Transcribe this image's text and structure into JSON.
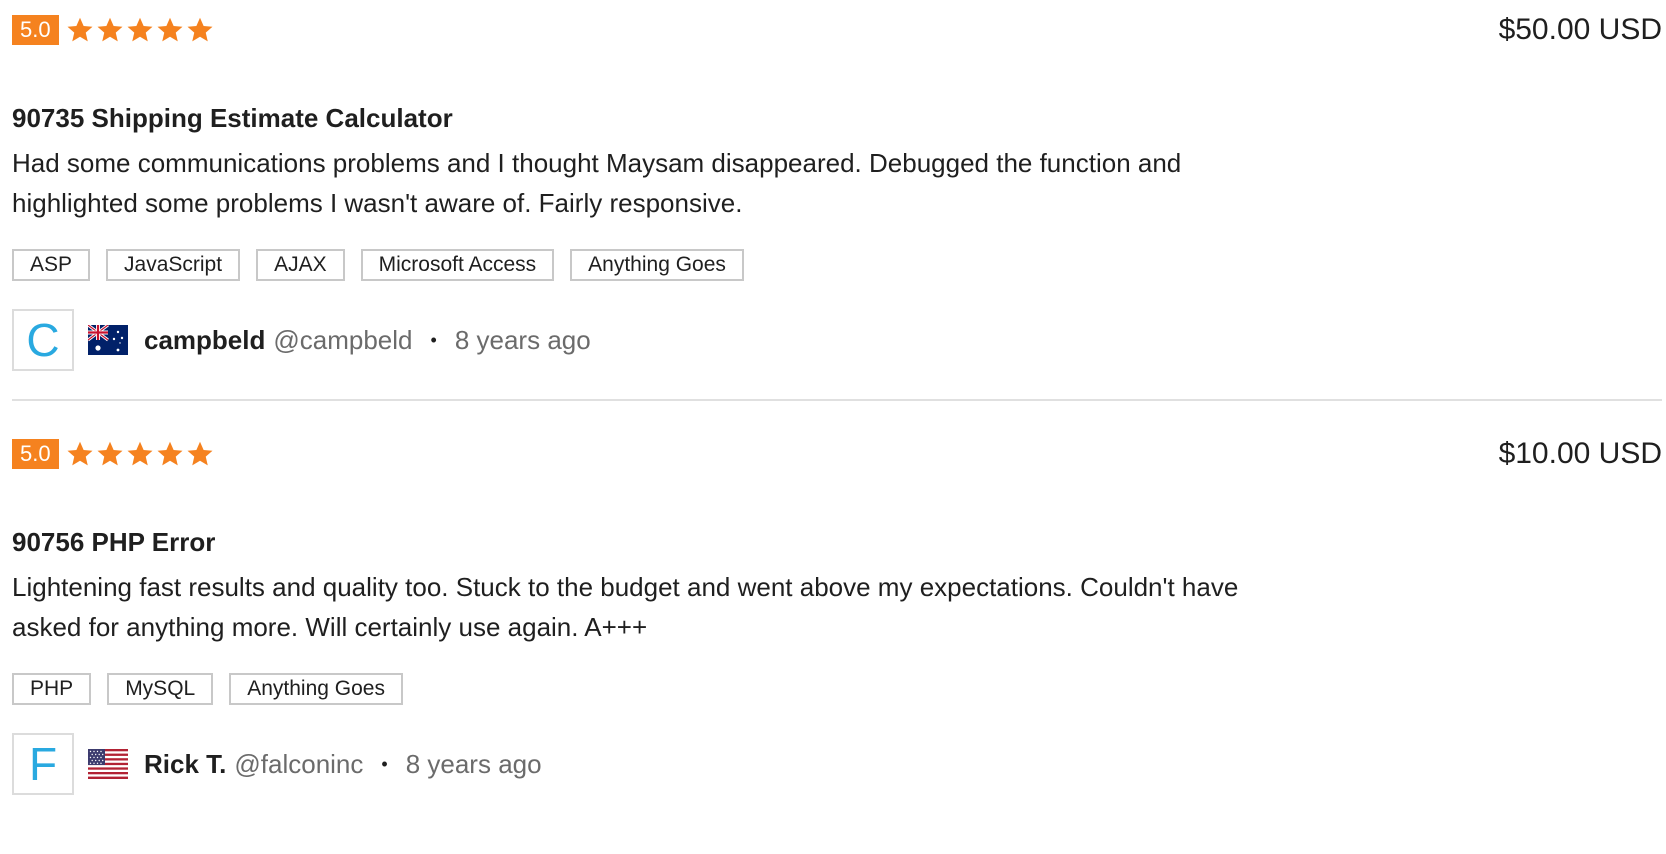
{
  "colors": {
    "accent": "#f5821f",
    "avatar_letter": "#29a9e0",
    "muted_text": "#6b6b6b",
    "tag_border": "#c8c8c8"
  },
  "reviews": [
    {
      "rating": "5.0",
      "stars": 5,
      "price": "$50.00 USD",
      "title": "90735 Shipping Estimate Calculator",
      "text": "Had some communications problems and I thought Maysam disappeared. Debugged the function and highlighted some problems I wasn't aware of. Fairly responsive.",
      "tags": [
        "ASP",
        "JavaScript",
        "AJAX",
        "Microsoft Access",
        "Anything Goes"
      ],
      "avatar_letter": "C",
      "flag": "australia-flag",
      "username": "campbeld",
      "handle": "@campbeld",
      "time_ago": "8 years ago"
    },
    {
      "rating": "5.0",
      "stars": 5,
      "price": "$10.00 USD",
      "title": "90756 PHP Error",
      "text": "Lightening fast results and quality too. Stuck to the budget and went above my expectations. Couldn't have asked for anything more. Will certainly use again. A+++",
      "tags": [
        "PHP",
        "MySQL",
        "Anything Goes"
      ],
      "avatar_letter": "F",
      "flag": "united-states-flag",
      "username": "Rick T.",
      "handle": "@falconinc",
      "time_ago": "8 years ago"
    }
  ]
}
